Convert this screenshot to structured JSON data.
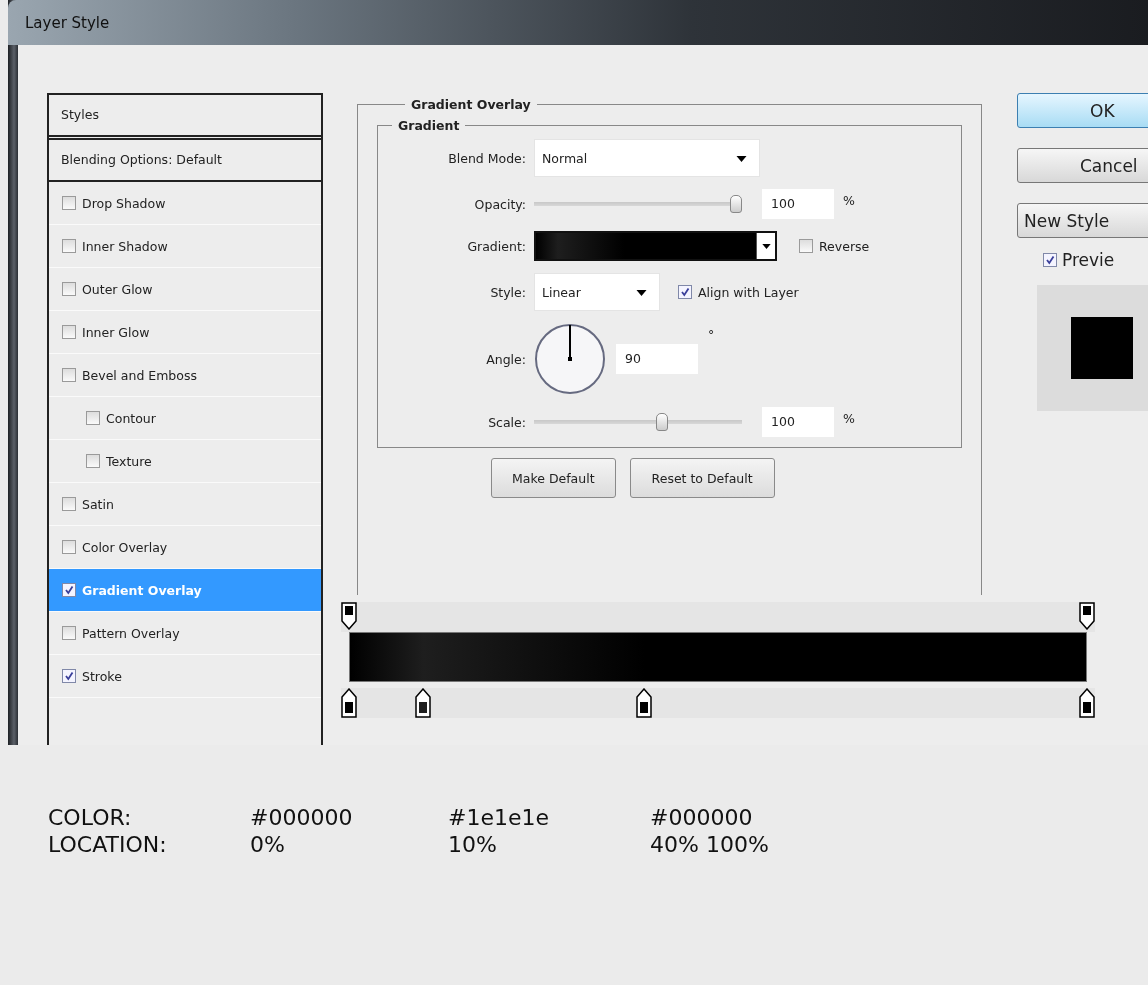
{
  "window": {
    "title": "Layer Style"
  },
  "styles_panel": {
    "header": "Styles",
    "blending_options": "Blending Options: Default",
    "items": [
      {
        "label": "Drop Shadow",
        "checked": false,
        "selected": false
      },
      {
        "label": "Inner Shadow",
        "checked": false,
        "selected": false
      },
      {
        "label": "Outer Glow",
        "checked": false,
        "selected": false
      },
      {
        "label": "Inner Glow",
        "checked": false,
        "selected": false
      },
      {
        "label": "Bevel and Emboss",
        "checked": false,
        "selected": false,
        "children": [
          {
            "label": "Contour",
            "checked": false,
            "selected": false
          },
          {
            "label": "Texture",
            "checked": false,
            "selected": false
          }
        ]
      },
      {
        "label": "Satin",
        "checked": false,
        "selected": false
      },
      {
        "label": "Color Overlay",
        "checked": false,
        "selected": false
      },
      {
        "label": "Gradient Overlay",
        "checked": true,
        "selected": true
      },
      {
        "label": "Pattern Overlay",
        "checked": false,
        "selected": false
      },
      {
        "label": "Stroke",
        "checked": true,
        "selected": false
      }
    ]
  },
  "gradient_overlay": {
    "title": "Gradient Overlay",
    "group_title": "Gradient",
    "blend_mode": {
      "label": "Blend Mode:",
      "value": "Normal"
    },
    "opacity": {
      "label": "Opacity:",
      "level": 1,
      "value": "100",
      "unit": "%"
    },
    "gradient": {
      "label": "Gradient:"
    },
    "reverse": {
      "label": "Reverse",
      "checked": false
    },
    "style": {
      "label": "Style:",
      "value": "Linear"
    },
    "align_with_layer": {
      "label": "Align with Layer",
      "checked": true
    },
    "angle": {
      "label": "Angle:",
      "value": "90",
      "unit": "°"
    },
    "scale": {
      "label": "Scale:",
      "level": 0.62,
      "value": "100",
      "unit": "%"
    },
    "buttons": [
      "Make Default",
      "Reset to Default"
    ]
  },
  "dialog_buttons": [
    {
      "label": "OK",
      "default": true
    },
    {
      "label": "Cancel",
      "default": false
    },
    {
      "label": "New Style",
      "default": false
    }
  ],
  "preview": {
    "label": "Previe",
    "checked": true
  },
  "gradient_editor": {
    "opacity_stops": [
      {
        "level": 0
      },
      {
        "level": 1
      }
    ],
    "color_stops": [
      {
        "level": 0,
        "color": "#000000"
      },
      {
        "level": 0.1,
        "color": "#1e1e1e"
      },
      {
        "level": 0.4,
        "color": "#000000"
      },
      {
        "level": 1,
        "color": "#000000"
      }
    ]
  },
  "notes": [
    {
      "label": "COLOR:",
      "values": [
        "#000000",
        "#1e1e1e",
        "#000000"
      ]
    },
    {
      "label": "LOCATION:",
      "values": [
        "0%",
        "10%",
        "40% 100%"
      ]
    }
  ]
}
